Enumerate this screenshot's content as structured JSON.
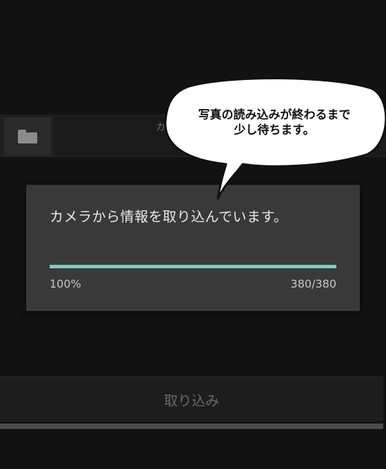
{
  "background": {
    "title_fragment": "カ"
  },
  "dialog": {
    "message": "カメラから情報を取り込んでいます。",
    "progress": {
      "percent_text": "100%",
      "count_text": "380/380",
      "fraction": 1.0
    }
  },
  "actions": {
    "import_label": "取り込み"
  },
  "annotation": {
    "line1": "写真の読み込みが終わるまで",
    "line2": "少し待ちます。"
  },
  "colors": {
    "progress_accent": "#80cbc4",
    "dialog_bg": "#393939",
    "screen_bg": "#121212"
  },
  "icons": {
    "folder": "folder-icon"
  }
}
